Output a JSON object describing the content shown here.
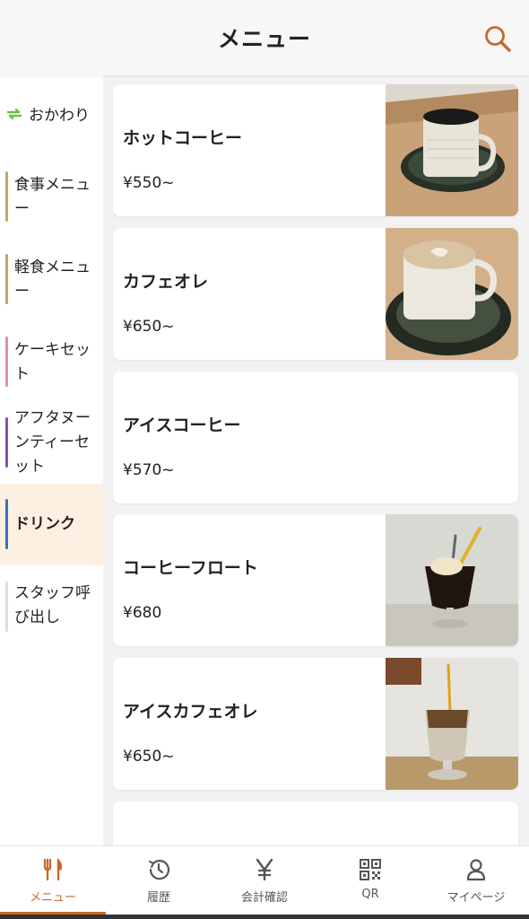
{
  "header": {
    "title": "メニュー"
  },
  "sidebar": {
    "refill_label": "おかわり",
    "categories": [
      {
        "label": "食事メニュー",
        "color": "#c9a46a"
      },
      {
        "label": "軽食メニュー",
        "color": "#c9a46a"
      },
      {
        "label": "ケーキセット",
        "color": "#e38bb4"
      },
      {
        "label": "アフタヌーンティーセット",
        "color": "#8a4fb0"
      },
      {
        "label": "ドリンク",
        "color": "#3f6fb5",
        "active": true
      },
      {
        "label": "スタッフ呼び出し",
        "color": "#dddddd"
      }
    ]
  },
  "items": [
    {
      "name": "ホットコーヒー",
      "price": "¥550~",
      "image": "hot-coffee-photo"
    },
    {
      "name": "カフェオレ",
      "price": "¥650~",
      "image": "cafe-au-lait-photo"
    },
    {
      "name": "アイスコーヒー",
      "price": "¥570~",
      "image": null
    },
    {
      "name": "コーヒーフロート",
      "price": "¥680",
      "image": "coffee-float-photo"
    },
    {
      "name": "アイスカフェオレ",
      "price": "¥650~",
      "image": "iced-cafe-au-lait-photo"
    }
  ],
  "tabbar": {
    "tabs": [
      {
        "label": "メニュー",
        "icon": "fork-knife-icon",
        "active": true
      },
      {
        "label": "履歴",
        "icon": "history-icon"
      },
      {
        "label": "会計確認",
        "icon": "yen-icon"
      },
      {
        "label": "QR",
        "icon": "qr-code-icon"
      },
      {
        "label": "マイページ",
        "icon": "person-icon"
      }
    ]
  },
  "colors": {
    "accent": "#c86a2a",
    "active_category_bg": "#fdf0e3",
    "refill_icon": "#6cc04a"
  }
}
